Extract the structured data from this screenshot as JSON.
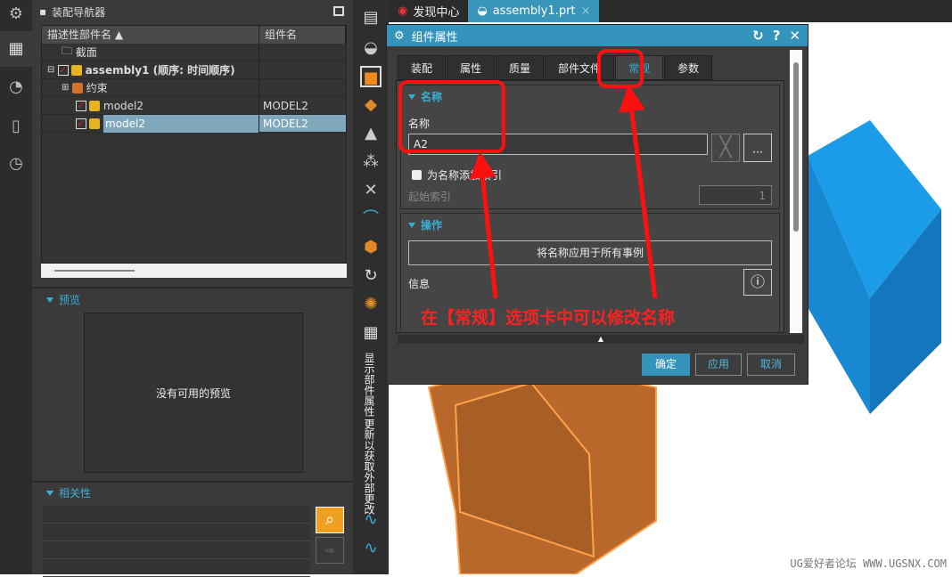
{
  "left_bar": {
    "icons": [
      "gear-icon",
      "assembly-navigator-icon",
      "part-navigator-icon",
      "reuse-library-icon",
      "history-icon"
    ]
  },
  "navigator": {
    "title": "装配导航器",
    "columns": [
      "描述性部件名",
      "组件名"
    ],
    "rows": [
      {
        "name": "截面",
        "component": ""
      },
      {
        "name": "assembly1 (顺序: 时间顺序)",
        "component": ""
      },
      {
        "name": "约束",
        "component": ""
      },
      {
        "name": "model2",
        "component": "MODEL2"
      },
      {
        "name": "model2",
        "component": "MODEL2"
      }
    ],
    "preview_title": "预览",
    "preview_empty": "没有可用的预览",
    "dependencies_title": "相关性"
  },
  "toolbar": {
    "vertical_labels": [
      "显示部件属性",
      "更新以获取外部更改"
    ]
  },
  "file_tabs": [
    {
      "label": "发现中心"
    },
    {
      "label": "assembly1.prt",
      "close": "×"
    }
  ],
  "dialog": {
    "title": "组件属性",
    "tabs": [
      "装配",
      "属性",
      "质量",
      "部件文件",
      "常规",
      "参数"
    ],
    "active_tab": "常规",
    "name_group": {
      "title": "名称",
      "label": "名称",
      "value": "A2",
      "add_index_label": "为名称添加索引",
      "add_index_checked": false,
      "start_index_label": "起始索引",
      "start_index_value": "1"
    },
    "ops_group": {
      "title": "操作",
      "apply_button": "将名称应用于所有事例",
      "info_label": "信息"
    },
    "ok": "确定",
    "apply": "应用",
    "cancel": "取消"
  },
  "annotation": "在【常规】选项卡中可以修改名称",
  "watermark": "UG爱好者论坛 WWW.UGSNX.COM"
}
